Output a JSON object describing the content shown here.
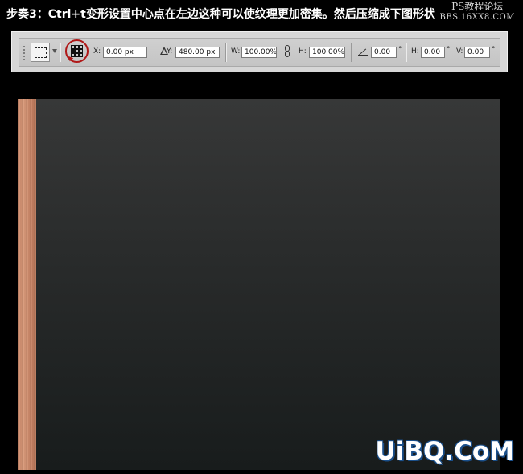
{
  "caption": "步奏3：Ctrl+t变形设置中心点在左边这种可以使纹理更加密集。然后压缩成下图形状",
  "watermark_top": {
    "line1": "PS教程论坛",
    "line2": "BBS.16XX8.COM"
  },
  "watermark_bottom": "UiBQ.CoM",
  "toolbar": {
    "tool_preset_icon": "marquee-transform-icon",
    "reference_point_icon": "reference-point-grid-icon",
    "reference_point_highlight_color": "#b01818",
    "x_label": "X:",
    "x_value": "0.00 px",
    "delta_icon": "relative-position-delta-icon",
    "y_label": "Y:",
    "y_value": "480.00 px",
    "w_label": "W:",
    "w_value": "100.00%",
    "link_icon": "maintain-aspect-ratio-link-icon",
    "h_label": "H:",
    "h_value": "100.00%",
    "angle_icon": "rotation-angle-icon",
    "angle_value": "0.00",
    "angle_unit": "°",
    "skew_h_label": "H:",
    "skew_h_value": "0.00",
    "skew_h_unit": "°",
    "skew_v_label": "V:",
    "skew_v_value": "0.00",
    "skew_v_unit": "°"
  },
  "colors": {
    "background": "#000000",
    "canvas_top": "#373838",
    "canvas_bottom": "#181c1c",
    "wood_strip": "#d99a7a",
    "watermark_outline": "#1a4f8a"
  }
}
